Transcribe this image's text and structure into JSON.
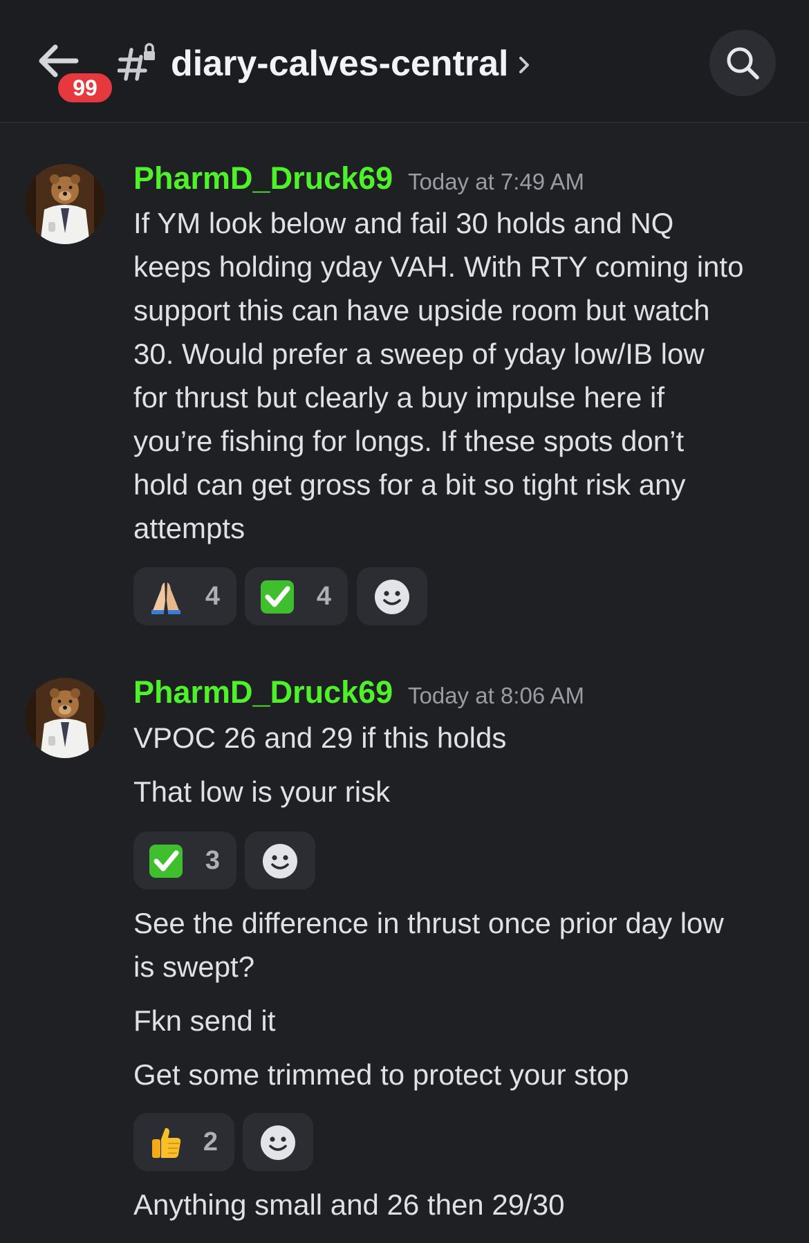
{
  "header": {
    "unread_count": "99",
    "channel_name": "diary-calves-central"
  },
  "messages": [
    {
      "author": "PharmD_Druck69",
      "timestamp": "Today at 7:49 AM",
      "lines": [
        "If YM look below and fail 30 holds and NQ",
        "keeps holding yday VAH. With RTY coming into",
        "support this can have upside room but watch",
        "30. Would prefer a sweep of yday low/IB low",
        "for thrust but clearly a buy impulse here if",
        "you’re fishing for longs. If these spots don’t",
        "hold can get gross for a bit so tight risk any",
        "attempts"
      ],
      "reactions": [
        {
          "emoji": "folded-hands",
          "count": "4"
        },
        {
          "emoji": "check-mark-button",
          "count": "4"
        }
      ]
    },
    {
      "author": "PharmD_Druck69",
      "timestamp": "Today at 8:06 AM",
      "lines": [
        "VPOC 26 and 29 if this holds"
      ],
      "followups": [
        {
          "lines": [
            "That low is your risk"
          ]
        },
        {
          "lines": [
            "See the difference in thrust once prior day low",
            "is swept?"
          ]
        },
        {
          "lines": [
            "Fkn send it"
          ]
        },
        {
          "lines": [
            "Get some trimmed to protect your stop"
          ]
        },
        {
          "lines": [
            "Anything small and 26 then 29/30"
          ]
        }
      ],
      "reactions_a": [
        {
          "emoji": "check-mark-button",
          "count": "3"
        }
      ],
      "reactions_b": [
        {
          "emoji": "thumbs-up",
          "count": "2"
        }
      ]
    }
  ],
  "colors": {
    "background": "#1f2024",
    "username": "#4ff12b",
    "badge": "#e5393f",
    "reaction_bg": "#2b2d32"
  }
}
